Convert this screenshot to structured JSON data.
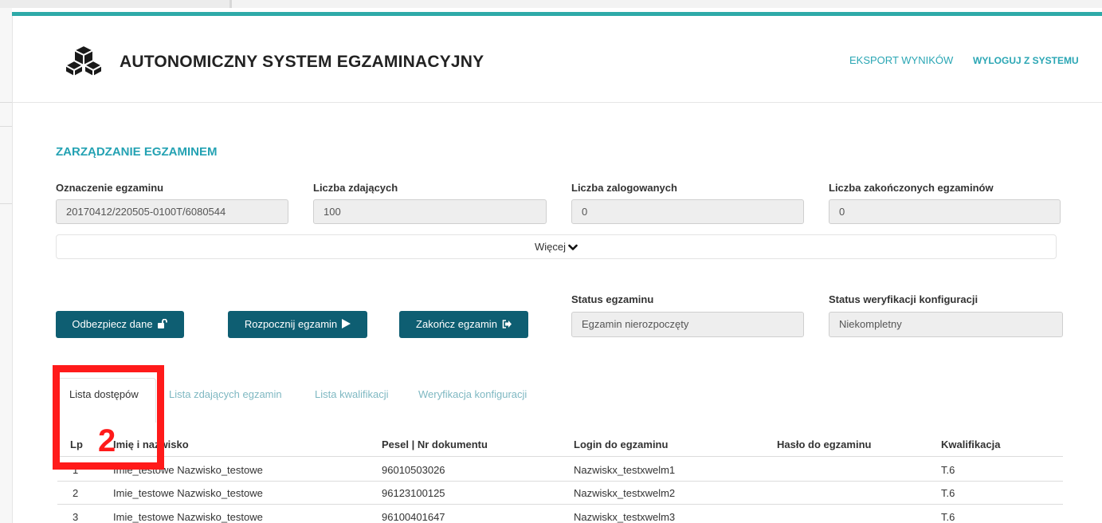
{
  "header": {
    "title": "AUTONOMICZNY SYSTEM EGZAMINACYJNY",
    "logo_icon": "cubes-icon",
    "nav": {
      "export": "EKSPORT WYNIKÓW",
      "logout": "WYLOGUJ Z SYSTEMU"
    }
  },
  "section": {
    "title": "ZARZĄDZANIE EGZAMINEM"
  },
  "fields": {
    "exam_id": {
      "label": "Oznaczenie egzaminu",
      "value": "20170412/220505-0100T/6080544"
    },
    "participants": {
      "label": "Liczba zdających",
      "value": "100"
    },
    "logged_in": {
      "label": "Liczba zalogowanych",
      "value": "0"
    },
    "finished": {
      "label": "Liczba zakończonych egzaminów",
      "value": "0"
    },
    "exam_status": {
      "label": "Status egzaminu",
      "value": "Egzamin nierozpoczęty"
    },
    "config_status": {
      "label": "Status weryfikacji konfiguracji",
      "value": "Niekompletny"
    }
  },
  "more": {
    "label": "Więcej",
    "icon": "chevron-down-icon"
  },
  "buttons": {
    "unlock": {
      "label": "Odbezpiecz dane",
      "icon": "unlock-icon"
    },
    "start": {
      "label": "Rozpocznij egzamin",
      "icon": "play-icon"
    },
    "finish": {
      "label": "Zakończ egzamin",
      "icon": "sign-out-icon"
    }
  },
  "tabs": [
    {
      "label": "Lista dostępów",
      "active": true
    },
    {
      "label": "Lista zdających egzamin",
      "active": false
    },
    {
      "label": "Lista kwalifikacji",
      "active": false
    },
    {
      "label": "Weryfikacja konfiguracji",
      "active": false
    }
  ],
  "table": {
    "columns": [
      "Lp",
      "Imię i nazwisko",
      "Pesel | Nr dokumentu",
      "Login do egzaminu",
      "Hasło do egzaminu",
      "Kwalifikacja"
    ],
    "rows": [
      [
        "1",
        "Imie_testowe Nazwisko_testowe",
        "96010503026",
        "Nazwiskx_testxwelm1",
        "",
        "T.6"
      ],
      [
        "2",
        "Imie_testowe Nazwisko_testowe",
        "96123100125",
        "Nazwiskx_testxwelm2",
        "",
        "T.6"
      ],
      [
        "3",
        "Imie_testowe Nazwisko_testowe",
        "96100401647",
        "Nazwiskx_testxwelm3",
        "",
        "T.6"
      ]
    ]
  },
  "annotation": {
    "number": "2",
    "color": "#ff1a1a"
  },
  "colors": {
    "accent": "#2eaaa8",
    "button": "#0e5e72",
    "link": "#2aa6b4"
  }
}
